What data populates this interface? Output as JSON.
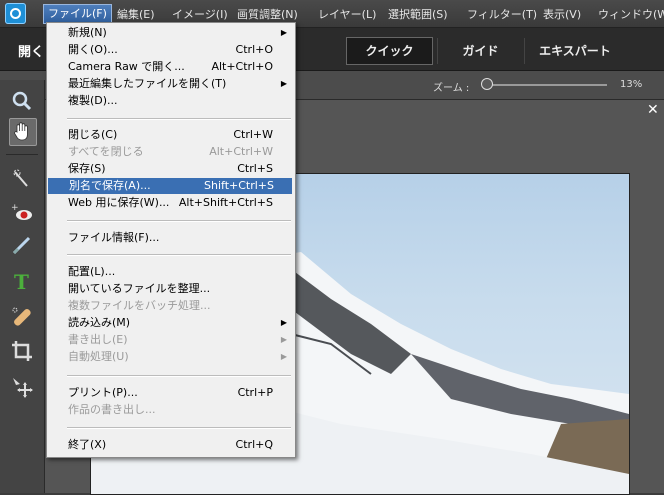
{
  "menubar": {
    "items": [
      {
        "label": "ファイル(F)"
      },
      {
        "label": "編集(E)"
      },
      {
        "label": "イメージ(I)"
      },
      {
        "label": "画質調整(N)"
      },
      {
        "label": "レイヤー(L)"
      },
      {
        "label": "選択範囲(S)"
      },
      {
        "label": "フィルター(T)"
      },
      {
        "label": "表示(V)"
      },
      {
        "label": "ウィンドウ(W)"
      }
    ]
  },
  "modebar": {
    "open_label": "開く",
    "modes": [
      "クイック",
      "ガイド",
      "エキスパート"
    ],
    "active_mode": "クイック"
  },
  "options": {
    "zoom_label": "ズーム :",
    "zoom_value": "13%",
    "zoom_level": 0.0
  },
  "tools": [
    "zoom-tool",
    "hand-tool",
    "quick-selection-tool",
    "red-eye-removal-tool",
    "whiten-teeth-tool",
    "type-tool",
    "spot-healing-brush-tool",
    "crop-tool",
    "move-tool"
  ],
  "file_menu": {
    "items": [
      {
        "label": "新規(N)",
        "shortcut": "",
        "submenu": true,
        "disabled": false
      },
      {
        "label": "開く(O)...",
        "shortcut": "Ctrl+O",
        "submenu": false,
        "disabled": false
      },
      {
        "label": "Camera Raw で開く...",
        "shortcut": "Alt+Ctrl+O",
        "submenu": false,
        "disabled": false
      },
      {
        "label": "最近編集したファイルを開く(T)",
        "shortcut": "",
        "submenu": true,
        "disabled": false
      },
      {
        "label": "複製(D)...",
        "shortcut": "",
        "submenu": false,
        "disabled": false
      },
      {
        "label": "閉じる(C)",
        "shortcut": "Ctrl+W",
        "submenu": false,
        "disabled": false
      },
      {
        "label": "すべてを閉じる",
        "shortcut": "Alt+Ctrl+W",
        "submenu": false,
        "disabled": true
      },
      {
        "label": "保存(S)",
        "shortcut": "Ctrl+S",
        "submenu": false,
        "disabled": false
      },
      {
        "label": "別名で保存(A)...",
        "shortcut": "Shift+Ctrl+S",
        "submenu": false,
        "disabled": false,
        "highlighted": true
      },
      {
        "label": "Web 用に保存(W)...",
        "shortcut": "Alt+Shift+Ctrl+S",
        "submenu": false,
        "disabled": false
      },
      {
        "label": "ファイル情報(F)...",
        "shortcut": "",
        "submenu": false,
        "disabled": false
      },
      {
        "label": "配置(L)...",
        "shortcut": "",
        "submenu": false,
        "disabled": false
      },
      {
        "label": "開いているファイルを整理...",
        "shortcut": "",
        "submenu": false,
        "disabled": false
      },
      {
        "label": "複数ファイルをバッチ処理...",
        "shortcut": "",
        "submenu": false,
        "disabled": true
      },
      {
        "label": "読み込み(M)",
        "shortcut": "",
        "submenu": true,
        "disabled": false
      },
      {
        "label": "書き出し(E)",
        "shortcut": "",
        "submenu": true,
        "disabled": true
      },
      {
        "label": "自動処理(U)",
        "shortcut": "",
        "submenu": true,
        "disabled": true
      },
      {
        "label": "プリント(P)...",
        "shortcut": "Ctrl+P",
        "submenu": false,
        "disabled": false
      },
      {
        "label": "作品の書き出し...",
        "shortcut": "",
        "submenu": false,
        "disabled": true
      },
      {
        "label": "終了(X)",
        "shortcut": "Ctrl+Q",
        "submenu": false,
        "disabled": false
      }
    ]
  },
  "colors": {
    "menu_highlight": "#3a6fb3",
    "app_accent": "#1e8fd6"
  }
}
